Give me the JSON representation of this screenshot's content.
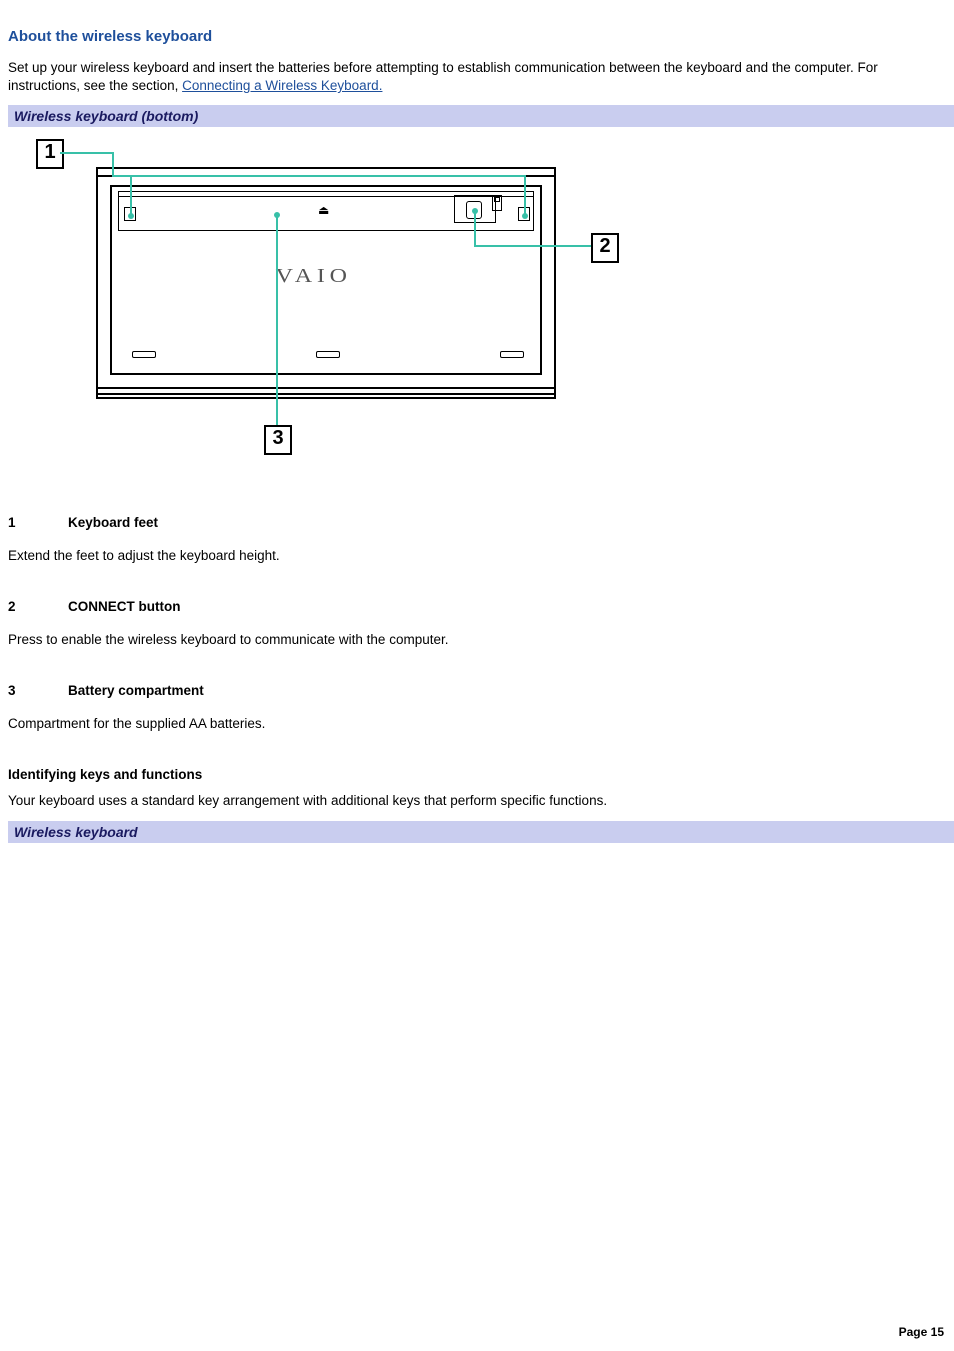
{
  "title": "About the wireless keyboard",
  "intro_part1": "Set up your wireless keyboard and insert the batteries before attempting to establish communication between the keyboard and the computer. For instructions, see the section, ",
  "intro_link_text": "Connecting a Wireless Keyboard.",
  "section_bar_1": "Wireless keyboard (bottom)",
  "labels": {
    "one": "1",
    "two": "2",
    "three": "3"
  },
  "figure_logo": "VAIO",
  "figure_eject_glyph": "⏏",
  "callouts": [
    {
      "num": "1",
      "label": "Keyboard feet",
      "desc": "Extend the feet to adjust the keyboard height."
    },
    {
      "num": "2",
      "label": "CONNECT button",
      "desc": "Press to enable the wireless keyboard to communicate with the computer."
    },
    {
      "num": "3",
      "label": "Battery compartment",
      "desc": "Compartment for the supplied AA batteries."
    }
  ],
  "subhead": "Identifying keys and functions",
  "subhead_desc": "Your keyboard uses a standard key arrangement with additional keys that perform specific functions.",
  "section_bar_2": "Wireless keyboard",
  "page_number": "Page 15"
}
